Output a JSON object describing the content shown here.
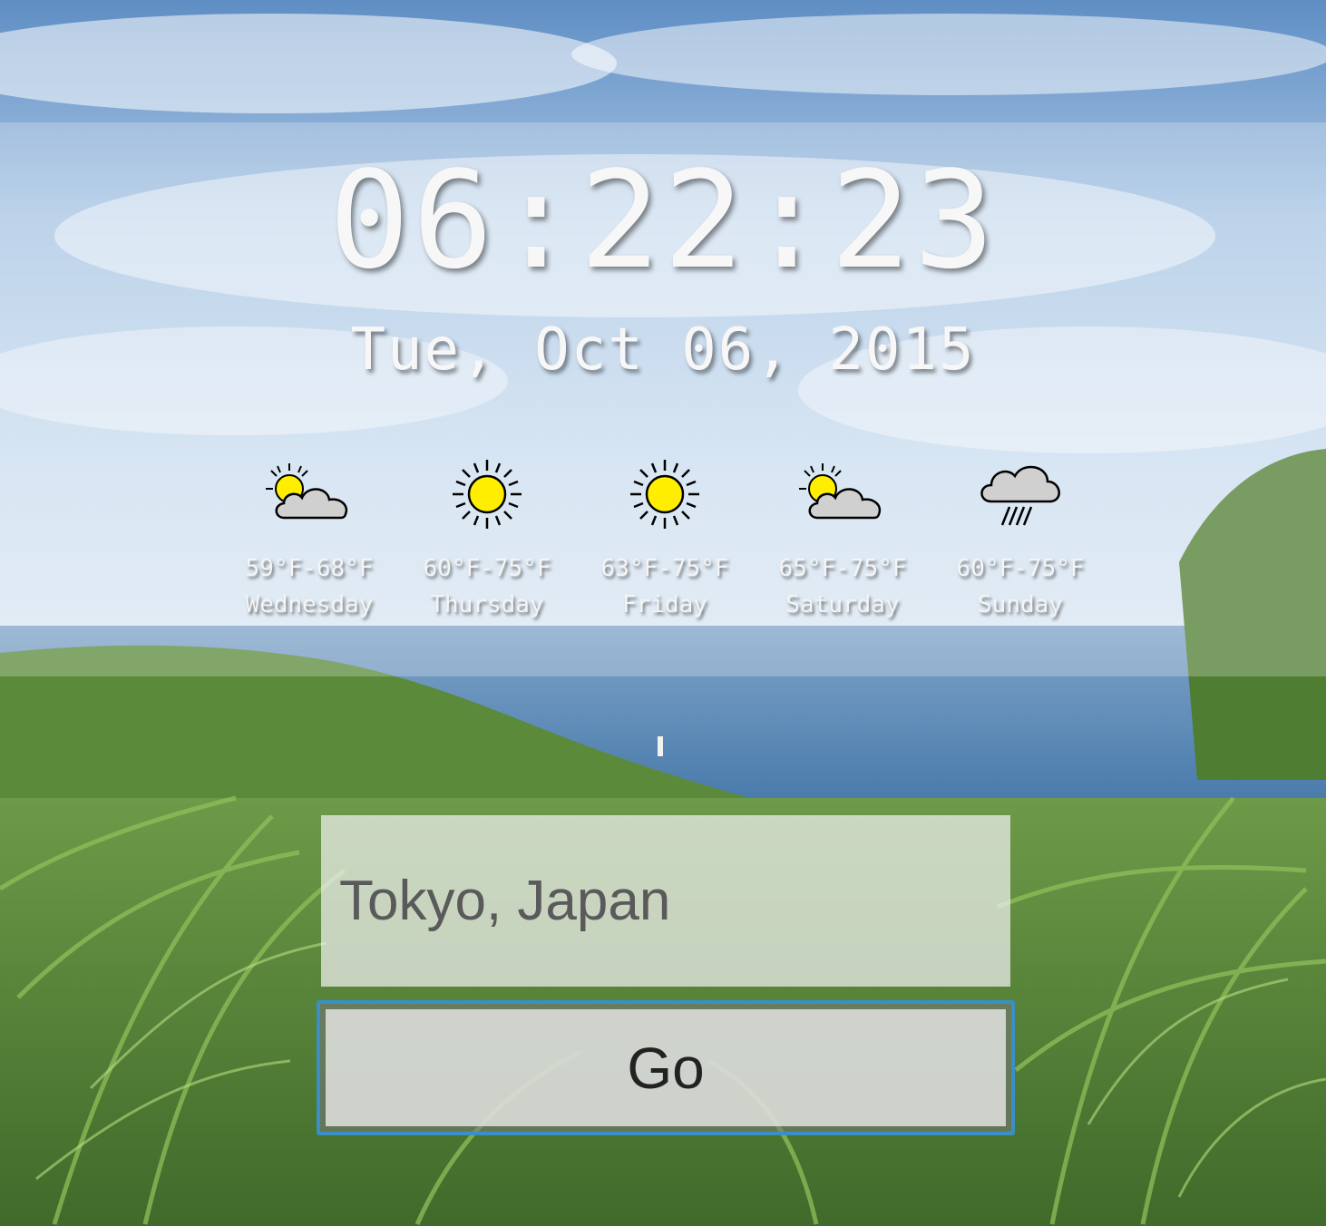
{
  "clock": {
    "time": "06:22:23",
    "date": "Tue, Oct 06, 2015"
  },
  "forecast": [
    {
      "day": "Wednesday",
      "temp": "59°F-68°F",
      "icon": "partly-cloudy-icon"
    },
    {
      "day": "Thursday",
      "temp": "60°F-75°F",
      "icon": "sunny-icon"
    },
    {
      "day": "Friday",
      "temp": "63°F-75°F",
      "icon": "sunny-icon"
    },
    {
      "day": "Saturday",
      "temp": "65°F-75°F",
      "icon": "partly-cloudy-icon"
    },
    {
      "day": "Sunday",
      "temp": "60°F-75°F",
      "icon": "rain-icon"
    }
  ],
  "location": {
    "value": "Tokyo, Japan",
    "go_label": "Go"
  },
  "colors": {
    "accent_border": "#3a8fc4",
    "sun": "#ffee00",
    "cloud": "#d0d0d0",
    "sky": "#6f9fcf",
    "sea": "#4d7fae",
    "foliage": "#5f8f3e"
  }
}
